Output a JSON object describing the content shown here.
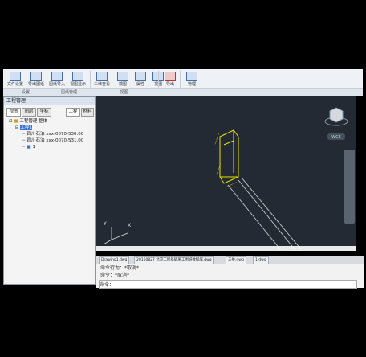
{
  "ribbon": {
    "buttons": [
      "文件设置",
      "导出图纸",
      "图纸导入",
      "视图显示",
      "二维查看",
      "截图",
      "属性",
      "视图",
      "导出",
      "管理"
    ],
    "groups": [
      "设置",
      "图纸管理",
      "视图"
    ]
  },
  "left_panel": {
    "title": "工程管理",
    "tabs": [
      "视图",
      "图层",
      "坐标",
      "工程",
      "材料"
    ],
    "tree": [
      "工程管理 整体",
      "工程1",
      "四川石油 xxx-0070-530.00",
      "四川石油 xxx-0070-531.00",
      "1"
    ]
  },
  "canvas": {
    "viewcube_label": "WCS"
  },
  "doc_tabs": [
    "Drawing1.dwg",
    "20160827 北京工程基础施工图纸数据库.dwg",
    "三维.dwg",
    "1.dwg"
  ],
  "command": {
    "line1": "命令行为：*取消*",
    "line2": "命令：*取消*",
    "prompt": "命令："
  },
  "colors": {
    "canvas_bg": "#232a33",
    "model_line": "#e8e000",
    "selection": "#3b77d6"
  }
}
